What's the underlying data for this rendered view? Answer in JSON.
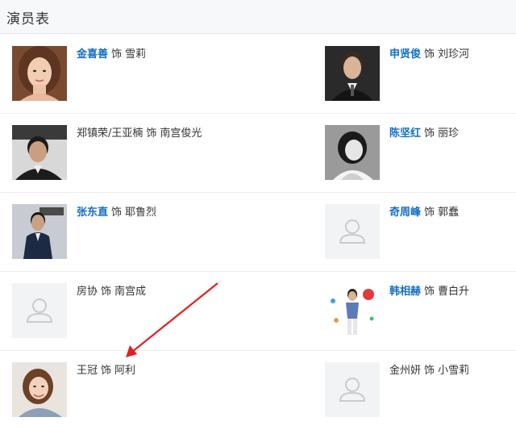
{
  "header": {
    "title": "演员表"
  },
  "cast": [
    [
      {
        "actor": "金喜善",
        "sep": "饰",
        "role": "雪莉",
        "actor_linked": true,
        "photo": "portrait-woman-brown-hair"
      },
      {
        "actor": "申贤俊",
        "sep": "饰",
        "role": "刘珍河",
        "actor_linked": true,
        "photo": "portrait-man-suit"
      }
    ],
    [
      {
        "actor": "郑镇荣/王亚楠",
        "sep": "饰",
        "role": "南宫俊光",
        "actor_linked": false,
        "photo": "portrait-man-dark-suit"
      },
      {
        "actor": "陈坚红",
        "sep": "饰",
        "role": "丽珍",
        "actor_linked": true,
        "photo": "portrait-woman-bw"
      }
    ],
    [
      {
        "actor": "张东直",
        "sep": "饰",
        "role": "耶鲁烈",
        "actor_linked": true,
        "photo": "portrait-man-poster"
      },
      {
        "actor": "奇周峰",
        "sep": "饰",
        "role": "郭蠢",
        "actor_linked": true,
        "photo": "placeholder-avatar"
      }
    ],
    [
      {
        "actor": "房协",
        "sep": "饰",
        "role": "南宫成",
        "actor_linked": false,
        "photo": "placeholder-avatar"
      },
      {
        "actor": "韩相赫",
        "sep": "饰",
        "role": "曹白升",
        "actor_linked": true,
        "photo": "portrait-man-colorful-poster"
      }
    ],
    [
      {
        "actor": "王冠",
        "sep": "饰",
        "role": "阿利",
        "actor_linked": false,
        "photo": "portrait-woman-smiling"
      },
      {
        "actor": "金州妍",
        "sep": "饰",
        "role": "小雪莉",
        "actor_linked": false,
        "photo": "placeholder-avatar"
      }
    ]
  ],
  "annotation": {
    "arrow_color": "#e02020",
    "target": "王冠"
  },
  "colors": {
    "link": "#136ec2",
    "text": "#333333",
    "header_bg": "#f7f8fa",
    "placeholder_bg": "#f2f3f5"
  }
}
